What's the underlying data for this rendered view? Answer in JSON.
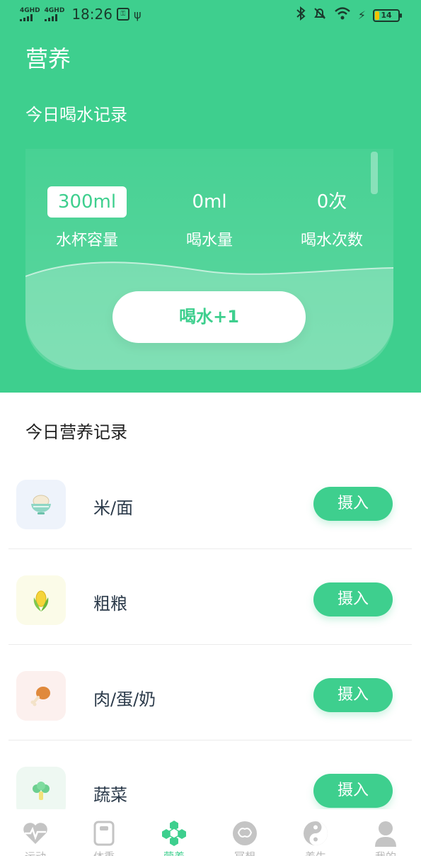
{
  "status_bar": {
    "network_1": "4GHD",
    "network_2": "4GHD",
    "time": "18:26",
    "battery": "14"
  },
  "header": {
    "title": "营养"
  },
  "water": {
    "section_title": "今日喝水记录",
    "stats": [
      {
        "value": "300ml",
        "label": "水杯容量"
      },
      {
        "value": "0ml",
        "label": "喝水量"
      },
      {
        "value": "0次",
        "label": "喝水次数"
      }
    ],
    "drink_button": "喝水+1"
  },
  "nutrition": {
    "section_title": "今日营养记录",
    "items": [
      {
        "name": "米/面",
        "button": "摄入",
        "icon": "rice-bowl-icon",
        "icon_bg": "#eef3fb"
      },
      {
        "name": "粗粮",
        "button": "摄入",
        "icon": "corn-icon",
        "icon_bg": "#fbfbe8"
      },
      {
        "name": "肉/蛋/奶",
        "button": "摄入",
        "icon": "chicken-leg-icon",
        "icon_bg": "#fcf0ee"
      },
      {
        "name": "蔬菜",
        "button": "摄入",
        "icon": "broccoli-icon",
        "icon_bg": "#eef8f2"
      }
    ]
  },
  "tabbar": {
    "items": [
      {
        "label": "运动",
        "icon": "heart-pulse-icon",
        "active": false
      },
      {
        "label": "体重",
        "icon": "scale-icon",
        "active": false
      },
      {
        "label": "营养",
        "icon": "nutrition-icon",
        "active": true
      },
      {
        "label": "冥想",
        "icon": "brain-icon",
        "active": false
      },
      {
        "label": "养生",
        "icon": "yin-yang-icon",
        "active": false
      },
      {
        "label": "我的",
        "icon": "user-icon",
        "active": false
      }
    ]
  },
  "colors": {
    "accent": "#3ecf8e",
    "text_dark": "#2b3a4a"
  }
}
